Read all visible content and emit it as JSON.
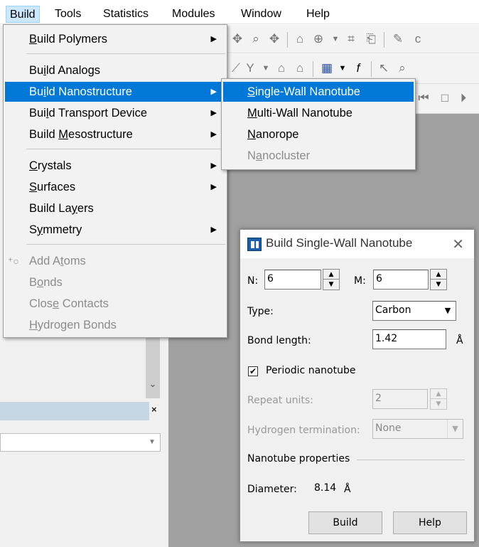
{
  "menubar": {
    "items": [
      "Build",
      "Tools",
      "Statistics",
      "Modules",
      "Window",
      "Help"
    ]
  },
  "build_menu": {
    "items": [
      {
        "label": "Build Polymers",
        "mnemonic_index": 0,
        "submenu": true,
        "enabled": true
      },
      {
        "label": "Build Analogs",
        "mnemonic_index": 2,
        "submenu": false,
        "enabled": true
      },
      {
        "label": "Build Nanostructure",
        "mnemonic_index": 2,
        "submenu": true,
        "enabled": true,
        "selected": true
      },
      {
        "label": "Build Transport Device",
        "mnemonic_index": 3,
        "submenu": true,
        "enabled": true
      },
      {
        "label": "Build Mesostructure",
        "mnemonic_index": 6,
        "submenu": true,
        "enabled": true
      },
      {
        "label": "Crystals",
        "mnemonic_index": 0,
        "submenu": true,
        "enabled": true
      },
      {
        "label": "Surfaces",
        "mnemonic_index": 0,
        "submenu": true,
        "enabled": true
      },
      {
        "label": "Build Layers",
        "mnemonic_index": 8,
        "submenu": false,
        "enabled": true
      },
      {
        "label": "Symmetry",
        "mnemonic_index": 1,
        "submenu": true,
        "enabled": true
      },
      {
        "label": "Add Atoms",
        "mnemonic_index": 5,
        "submenu": false,
        "enabled": false
      },
      {
        "label": "Bonds",
        "mnemonic_index": 1,
        "submenu": false,
        "enabled": false
      },
      {
        "label": "Close Contacts",
        "mnemonic_index": 4,
        "submenu": false,
        "enabled": false
      },
      {
        "label": "Hydrogen Bonds",
        "mnemonic_index": 0,
        "submenu": false,
        "enabled": false
      }
    ]
  },
  "nano_submenu": {
    "items": [
      {
        "label": "Single-Wall Nanotube",
        "mnemonic_index": 0,
        "enabled": true,
        "selected": true
      },
      {
        "label": "Multi-Wall Nanotube",
        "mnemonic_index": 0,
        "enabled": true
      },
      {
        "label": "Nanorope",
        "mnemonic_index": 0,
        "enabled": true
      },
      {
        "label": "Nanocluster",
        "mnemonic_index": 1,
        "enabled": false
      }
    ]
  },
  "dialog": {
    "title": "Build Single-Wall Nanotube",
    "n_label": "N:",
    "n_value": "6",
    "m_label": "M:",
    "m_value": "6",
    "type_label": "Type:",
    "type_value": "Carbon",
    "bond_length_label": "Bond length:",
    "bond_length_value": "1.42",
    "bond_length_unit": "Å",
    "periodic_label": "Periodic nanotube",
    "periodic_checked": true,
    "repeat_units_label": "Repeat units:",
    "repeat_units_value": "2",
    "hydrogen_label": "Hydrogen termination:",
    "hydrogen_value": "None",
    "properties_label": "Nanotube properties",
    "diameter_label": "Diameter:",
    "diameter_value": "8.14",
    "diameter_unit": "Å",
    "build_button": "Build",
    "help_button": "Help"
  },
  "colors": {
    "menu_highlight": "#0078d7",
    "menubar_active": "#cce8ff",
    "disabled_text": "#8c8c8c",
    "workspace_gray": "#a0a0a0"
  }
}
